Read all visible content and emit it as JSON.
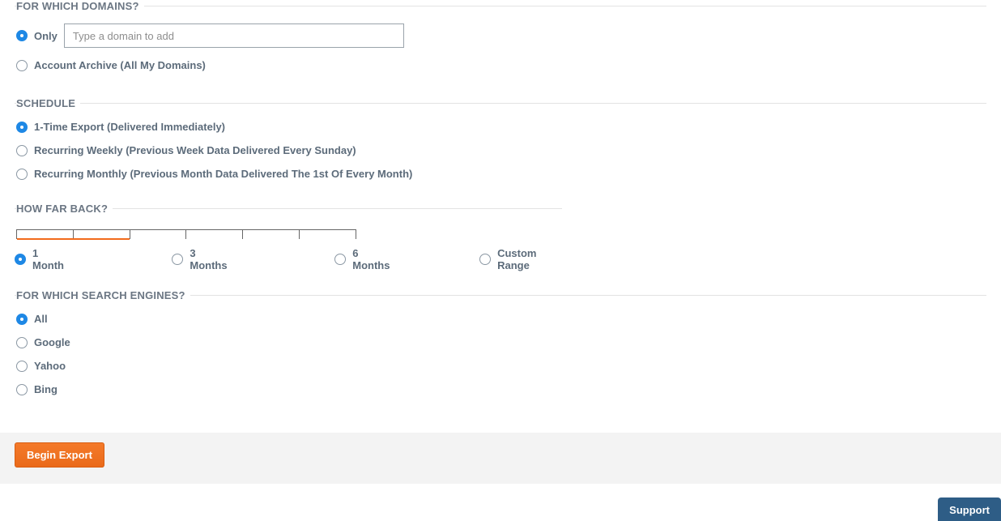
{
  "domains": {
    "title": "FOR WHICH DOMAINS?",
    "only_label": "Only",
    "only_selected": true,
    "domain_placeholder": "Type a domain to add",
    "domain_value": "",
    "archive_label": "Account Archive (All My Domains)",
    "archive_selected": false
  },
  "schedule": {
    "title": "SCHEDULE",
    "options": [
      {
        "label": "1-Time Export (Delivered Immediately)",
        "selected": true
      },
      {
        "label": "Recurring Weekly (Previous Week Data Delivered Every Sunday)",
        "selected": false
      },
      {
        "label": "Recurring Monthly (Previous Month Data Delivered The 1st Of Every Month)",
        "selected": false
      }
    ]
  },
  "howfar": {
    "title": "HOW FAR BACK?",
    "slider_segments": 6,
    "fill_segments": 2,
    "options": [
      {
        "label": "1 Month",
        "selected": true
      },
      {
        "label": "3 Months",
        "selected": false
      },
      {
        "label": "6 Months",
        "selected": false
      },
      {
        "label": "Custom Range",
        "selected": false
      }
    ]
  },
  "engines": {
    "title": "FOR WHICH SEARCH ENGINES?",
    "options": [
      {
        "label": "All",
        "selected": true
      },
      {
        "label": "Google",
        "selected": false
      },
      {
        "label": "Yahoo",
        "selected": false
      },
      {
        "label": "Bing",
        "selected": false
      }
    ]
  },
  "buttons": {
    "begin": "Begin Export",
    "support": "Support"
  },
  "colors": {
    "accent_orange": "#f26a1b",
    "radio_blue": "#1e88e5",
    "support_blue": "#2e5d86"
  }
}
